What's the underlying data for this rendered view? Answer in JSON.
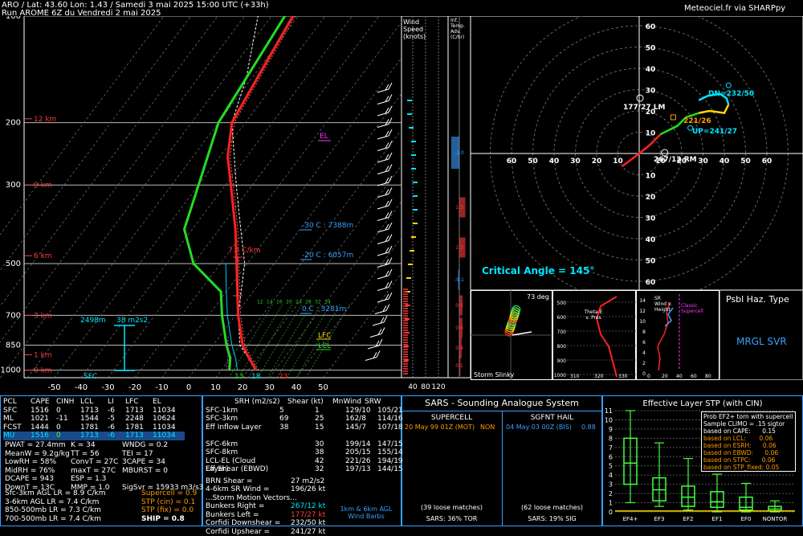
{
  "header": {
    "line1": "ARO / Lat: 43.60 Lon: 1.43 / Samedi 3 mai 2025 15:00 UTC (+33h)",
    "line2": "Run AROME 6Z du Vendredi 2 mai 2025",
    "credit": "Meteociel.fr via SHARPpy"
  },
  "chart_data": [
    {
      "type": "line",
      "name": "skew-t",
      "y_ticks": [
        "100",
        "200",
        "300",
        "500",
        "700",
        "850",
        "1000"
      ],
      "x_ticks": [
        "-50",
        "-40",
        "-30",
        "-20",
        "-10",
        "0",
        "10",
        "20",
        "30",
        "40",
        "50"
      ],
      "height_labels": [
        "12 km",
        "9 km",
        "6 km",
        "3 km",
        "1 km",
        "0 km"
      ],
      "temperature_profile": [
        [
          1000,
          23
        ],
        [
          925,
          17
        ],
        [
          850,
          11
        ],
        [
          700,
          1
        ],
        [
          500,
          -14
        ],
        [
          400,
          -24
        ],
        [
          300,
          -38
        ],
        [
          250,
          -47
        ],
        [
          200,
          -55
        ],
        [
          150,
          -58
        ],
        [
          100,
          -62
        ]
      ],
      "dewpoint_profile": [
        [
          1000,
          13
        ],
        [
          925,
          10
        ],
        [
          850,
          5
        ],
        [
          700,
          -5
        ],
        [
          600,
          -12
        ],
        [
          500,
          -30
        ],
        [
          400,
          -43
        ],
        [
          300,
          -50
        ],
        [
          200,
          -60
        ],
        [
          100,
          -65
        ]
      ],
      "annotations": [
        "EL",
        "-30 C : 7388m",
        "-20 C : 6057m",
        "7.6 C/km",
        "0 C : 3281m",
        "LFC",
        "LCL",
        "2498m",
        "38 m2s2",
        "SFC"
      ],
      "wet_bulb_labels": [
        "12",
        "14",
        "16",
        "20",
        "24",
        "28",
        "32",
        "34"
      ],
      "bottom_labels": [
        "13",
        "18",
        "23"
      ]
    },
    {
      "type": "bar",
      "name": "wind-speed",
      "title": "Wind Speed (knots)",
      "x_ticks": [
        "40",
        "80",
        "120"
      ],
      "inflow_header": "Inf. Temp. Adv. (C/hr)",
      "adv_values": [
        "-2.0",
        "1.3",
        "1.3",
        "-0.1",
        "0.6",
        "0.6",
        "0.4",
        "0.1"
      ]
    },
    {
      "type": "line",
      "name": "hodograph",
      "ring_labels": [
        "10",
        "20",
        "30",
        "40",
        "50",
        "60"
      ],
      "labels": {
        "lm": "177/27 LM",
        "rm": "267/12 RM",
        "dn": "DN=232/50",
        "up": "UP=241/27",
        "mean": "221/26"
      },
      "critical_angle": "Critical Angle = 145°"
    }
  ],
  "storm_slinky": {
    "title": "Storm Slinky",
    "deg": "73 deg"
  },
  "theta_e": {
    "title": "Theta-E v. Pres",
    "x_ticks": [
      "310",
      "320",
      "330"
    ],
    "y_ticks": [
      "500",
      "600",
      "700",
      "800",
      "900",
      "1000"
    ]
  },
  "srwind": {
    "title": "SR Wind v. Height",
    "y_ticks": [
      "14",
      "12",
      "10",
      "8",
      "6",
      "4",
      "2",
      "0"
    ],
    "x_ticks": [
      "0",
      "20",
      "40",
      "60",
      "80"
    ],
    "note": "Classic Supercell"
  },
  "hazard": {
    "title": "Psbl Haz. Type",
    "value": "MRGL SVR"
  },
  "parcel_table": {
    "headers": [
      "PCL",
      "CAPE",
      "CINH",
      "LCL",
      "LI",
      "LFC",
      "EL"
    ],
    "rows": [
      [
        "SFC",
        "1516",
        "0",
        "1713",
        "-6",
        "1713",
        "11034"
      ],
      [
        "ML",
        "1021",
        "-11",
        "1544",
        "-5",
        "2248",
        "10624"
      ],
      [
        "FCST",
        "1444",
        "0",
        "1781",
        "-6",
        "1781",
        "11034"
      ],
      [
        "MU",
        "1516",
        "0",
        "1713",
        "-6",
        "1713",
        "11034"
      ]
    ]
  },
  "thermo": {
    "col1": [
      "PWAT = 27.4mm",
      "MeanW = 9.2g/kg",
      "LowRH = 58%",
      "MidRH = 76%",
      "DCAPE = 943",
      "DownT = 13C"
    ],
    "col2": [
      "K = 34",
      "TT = 56",
      "ConvT = 27C",
      "maxT = 27C",
      "ESP = 1.3",
      "MMP = 1.0"
    ],
    "col3": [
      "WNDG = 0.2",
      "TEI = 17",
      "3CAPE = 34",
      "MBURST = 0",
      "",
      "SigSvr = 15933 m3/s3"
    ],
    "lapse": [
      "Sfc-3km AGL LR = 8.9 C/km",
      "3-6km AGL LR = 7.4 C/km",
      "850-500mb LR = 7.3 C/km",
      "700-500mb LR = 7.4 C/km"
    ],
    "composite": [
      "Supercell = 0.9",
      "STP (cin) = 0.1",
      "STP (fix) = 0.0",
      "SHIP = 0.8"
    ]
  },
  "kinematic": {
    "headers": [
      "SRH (m2/s2)",
      "Shear (kt)",
      "MnWind",
      "SRW"
    ],
    "rows": [
      [
        "SFC-1km",
        "5",
        "1",
        "129/10",
        "105/21"
      ],
      [
        "SFC-3km",
        "69",
        "25",
        "162/8",
        "114/16"
      ],
      [
        "Eff Inflow Layer",
        "38",
        "15",
        "145/7",
        "107/18"
      ],
      [
        "",
        "",
        "",
        "",
        ""
      ],
      [
        "SFC-6km",
        "",
        "30",
        "199/14",
        "147/15"
      ],
      [
        "SFC-8km",
        "",
        "38",
        "205/15",
        "155/14"
      ],
      [
        "LCL-EL (Cloud Layer)",
        "",
        "42",
        "221/26",
        "194/19"
      ],
      [
        "Eff Shear (EBWD)",
        "",
        "32",
        "197/13",
        "144/15"
      ]
    ],
    "brn": [
      "BRN Shear =",
      "27 m2/s2"
    ],
    "sr46": [
      "4-6km SR Wind =",
      "196/26 kt"
    ],
    "motion_title": "...Storm Motion Vectors...",
    "motions": [
      [
        "Bunkers Right =",
        "267/12 kt"
      ],
      [
        "Bunkers Left =",
        "177/27 kt"
      ],
      [
        "Corfidi Downshear =",
        "232/50 kt"
      ],
      [
        "Corfidi Upshear =",
        "241/27 kt"
      ]
    ],
    "barbs_label": "1km & 6km AGL Wind Barbs"
  },
  "sars": {
    "title": "SARS - Sounding Analogue System",
    "supercell_title": "SUPERCELL",
    "supercell_match": "20 May 99 01Z (MOT)",
    "supercell_type": "NON",
    "hail_title": "SGFNT HAIL",
    "hail_match": "04 May 03 00Z (BIS)",
    "hail_value": "0.88",
    "supercell_count": "(39 loose matches)",
    "supercell_pct": "SARS: 36% TOR",
    "hail_count": "(62 loose matches)",
    "hail_pct": "SARS: 19% SIG"
  },
  "stp": {
    "title": "Effective Layer STP (with CIN)",
    "categories": [
      "EF4+",
      "EF3",
      "EF2",
      "EF1",
      "EF0",
      "NONTOR"
    ],
    "y_ticks": [
      "0",
      "1",
      "2",
      "3",
      "4",
      "5",
      "6",
      "7",
      "8",
      "9",
      "10",
      "11"
    ],
    "boxes": [
      {
        "min": 1.0,
        "q1": 3.0,
        "med": 5.3,
        "q3": 8.0,
        "max": 11.0
      },
      {
        "min": 0.6,
        "q1": 1.2,
        "med": 2.4,
        "q3": 3.7,
        "max": 7.5
      },
      {
        "min": 0.2,
        "q1": 0.6,
        "med": 1.6,
        "q3": 2.8,
        "max": 5.8
      },
      {
        "min": 0.0,
        "q1": 0.5,
        "med": 1.1,
        "q3": 2.2,
        "max": 4.1
      },
      {
        "min": 0.0,
        "q1": 0.2,
        "med": 0.5,
        "q3": 1.6,
        "max": 3.1
      },
      {
        "min": 0.0,
        "q1": 0.1,
        "med": 0.3,
        "q3": 0.6,
        "max": 1.2
      }
    ],
    "stp_value": 0.1,
    "prob_lines": [
      "Prob EF2+ torn with supercell",
      "Sample CLIMO = .15 sigtor",
      "based on CAPE:      0.15",
      "based on LCL:       0.06",
      "based on ESRH:      0.06",
      "based on EBWD:      0.06",
      "based on STPC:      0.06",
      "based on STP_fixed: 0.05"
    ]
  }
}
